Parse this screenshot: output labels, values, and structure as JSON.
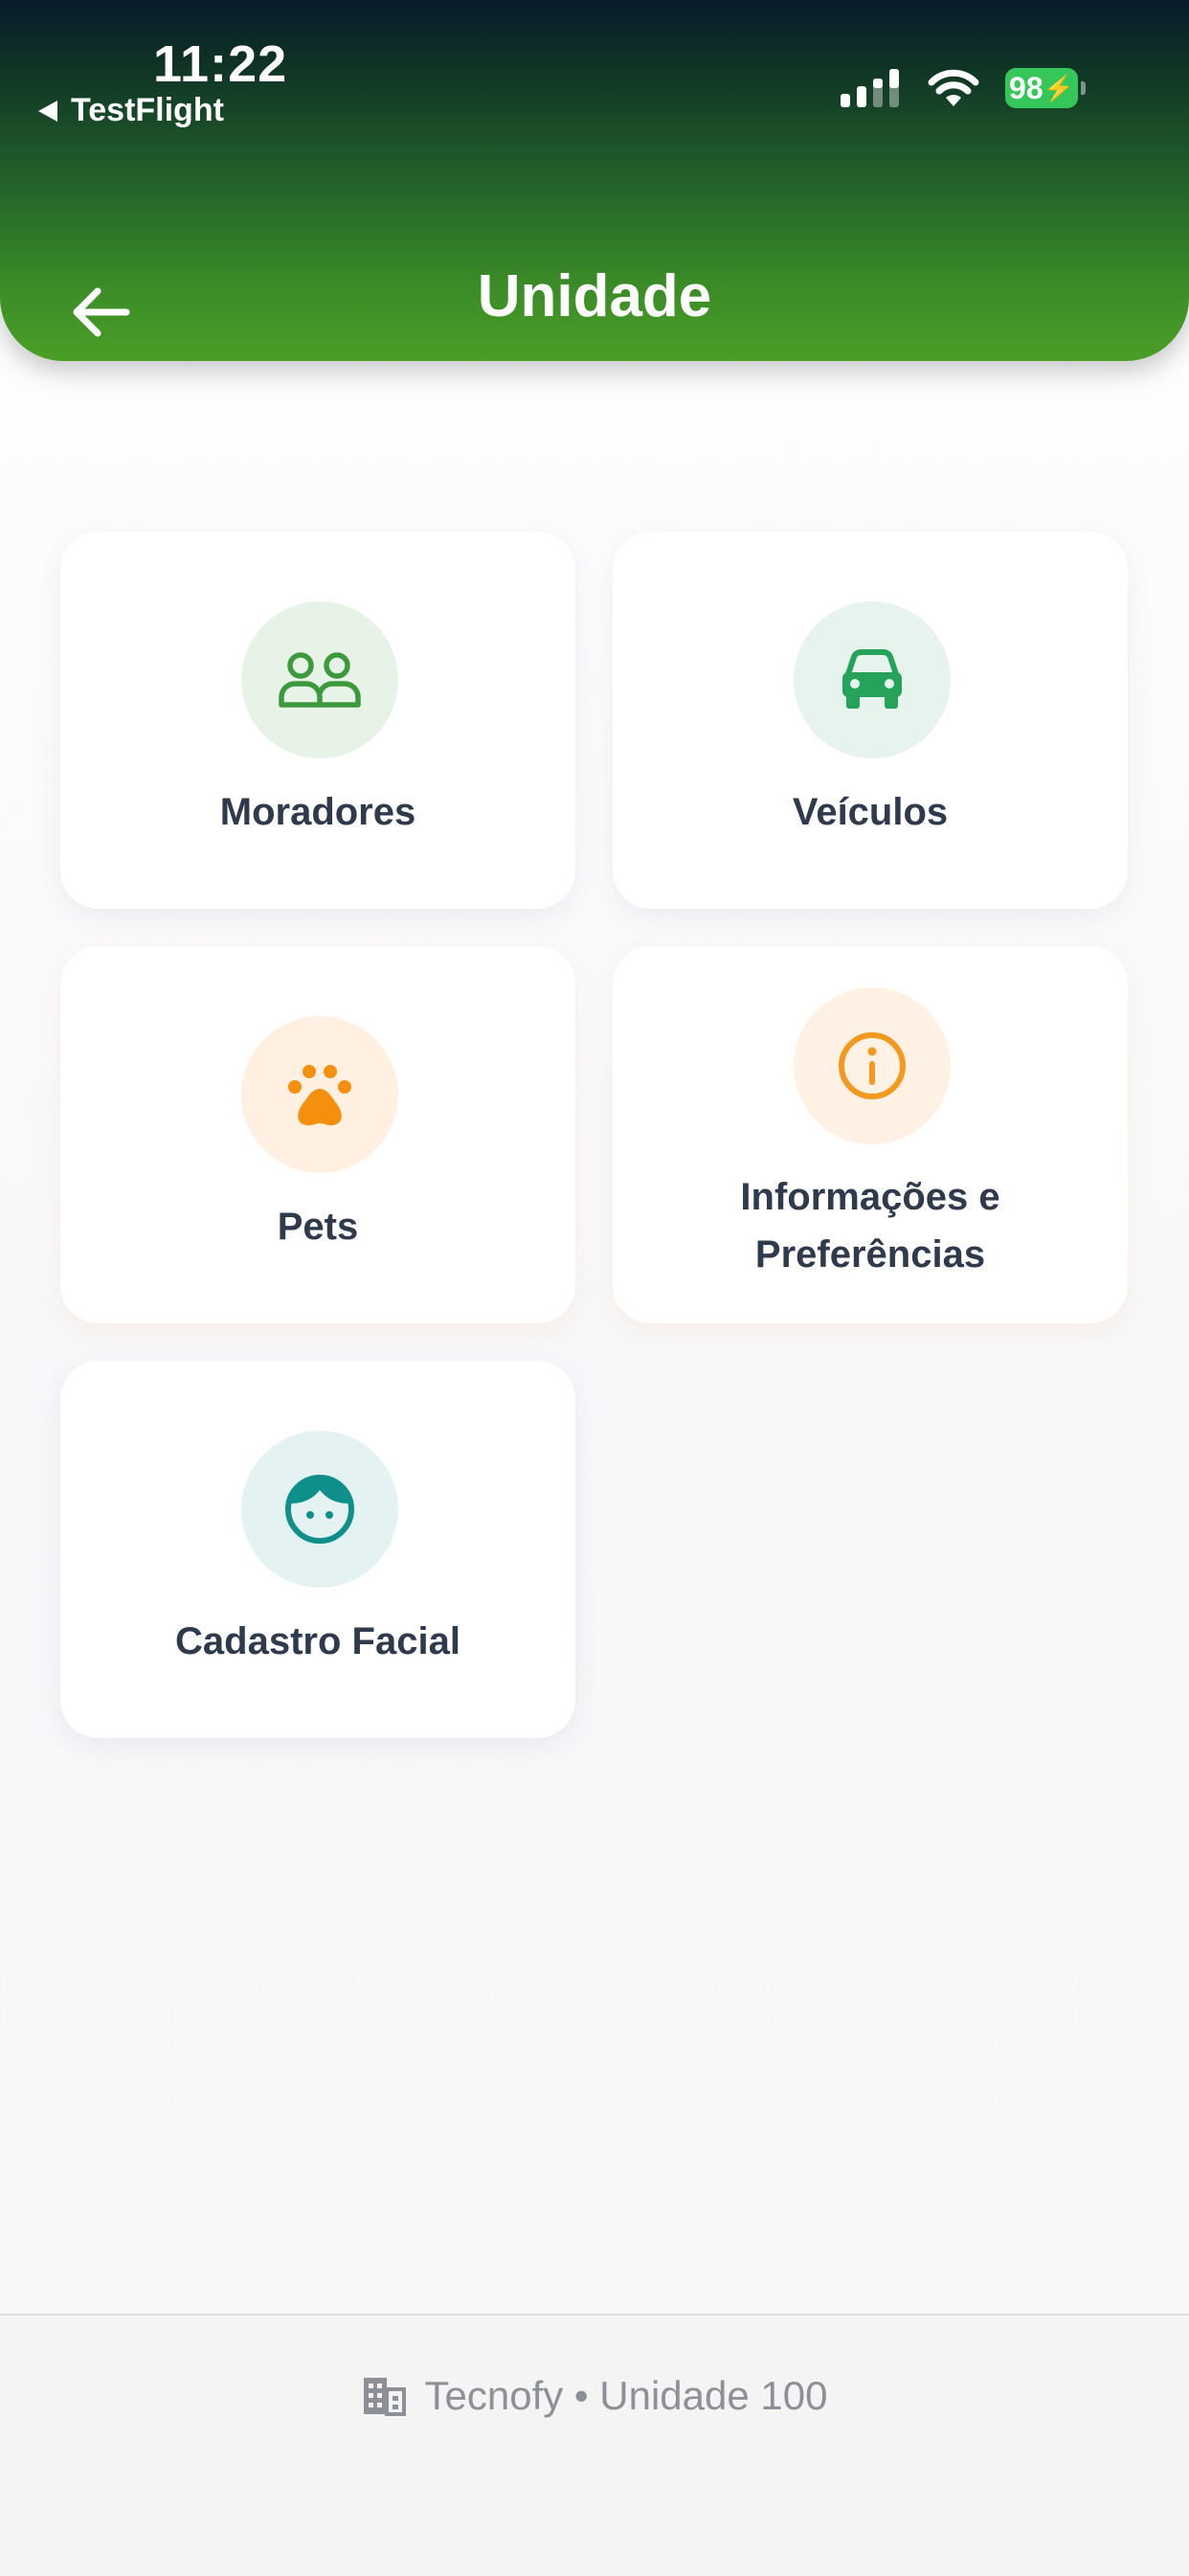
{
  "status_bar": {
    "time": "11:22",
    "back_app_label": "TestFlight",
    "battery_level": "98",
    "icons": [
      "signal-icon",
      "wifi-icon",
      "battery-icon"
    ]
  },
  "header": {
    "title": "Unidade",
    "back_icon": "arrow-left-icon",
    "gradient_colors": [
      "#071a2a",
      "#4a9f26"
    ]
  },
  "menu": {
    "items": [
      {
        "label": "Moradores",
        "icon": "people-icon",
        "icon_color": "#3c9a3c",
        "circle_color": "#e8f3e8"
      },
      {
        "label": "Veículos",
        "icon": "car-icon",
        "icon_color": "#25a35a",
        "circle_color": "#e7f4ee"
      },
      {
        "label": "Pets",
        "icon": "paw-icon",
        "icon_color": "#f5900f",
        "circle_color": "#fff0e2"
      },
      {
        "label": "Informações e\nPreferências",
        "icon": "info-icon",
        "icon_color": "#f29a1f",
        "circle_color": "#fff1e3"
      },
      {
        "label": "Cadastro Facial",
        "icon": "face-icon",
        "icon_color": "#0f8f8a",
        "circle_color": "#e4f3f2"
      }
    ]
  },
  "footer": {
    "text": "Tecnofy • Unidade 100",
    "icon": "building-icon"
  }
}
